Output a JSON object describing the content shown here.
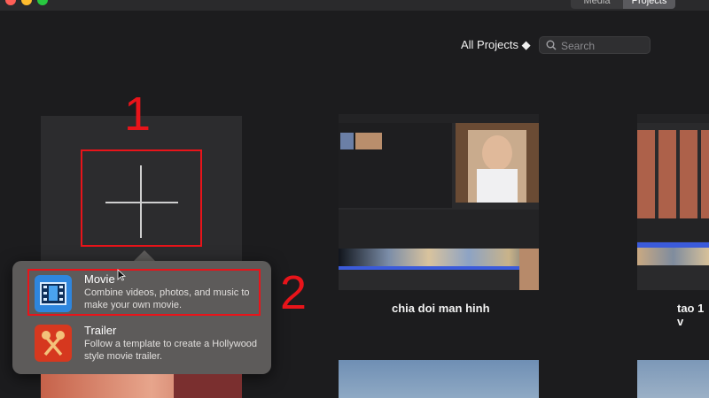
{
  "window": {
    "tabs": [
      {
        "label": "Media",
        "active": false
      },
      {
        "label": "Projects",
        "active": true
      }
    ]
  },
  "toolbar": {
    "filter_label": "All Projects ◆",
    "search_placeholder": "Search"
  },
  "annotations": {
    "step1": "1",
    "step2": "2",
    "color": "#e8141a"
  },
  "new_project_menu": {
    "options": [
      {
        "title": "Movie",
        "description": "Combine videos, photos, and music to make your own movie.",
        "icon": "film-icon"
      },
      {
        "title": "Trailer",
        "description": "Follow a template to create a Hollywood style movie trailer.",
        "icon": "trailer-icon"
      }
    ]
  },
  "projects": [
    {
      "title": "chia doi man hinh"
    },
    {
      "title": "tao 1 v"
    }
  ]
}
